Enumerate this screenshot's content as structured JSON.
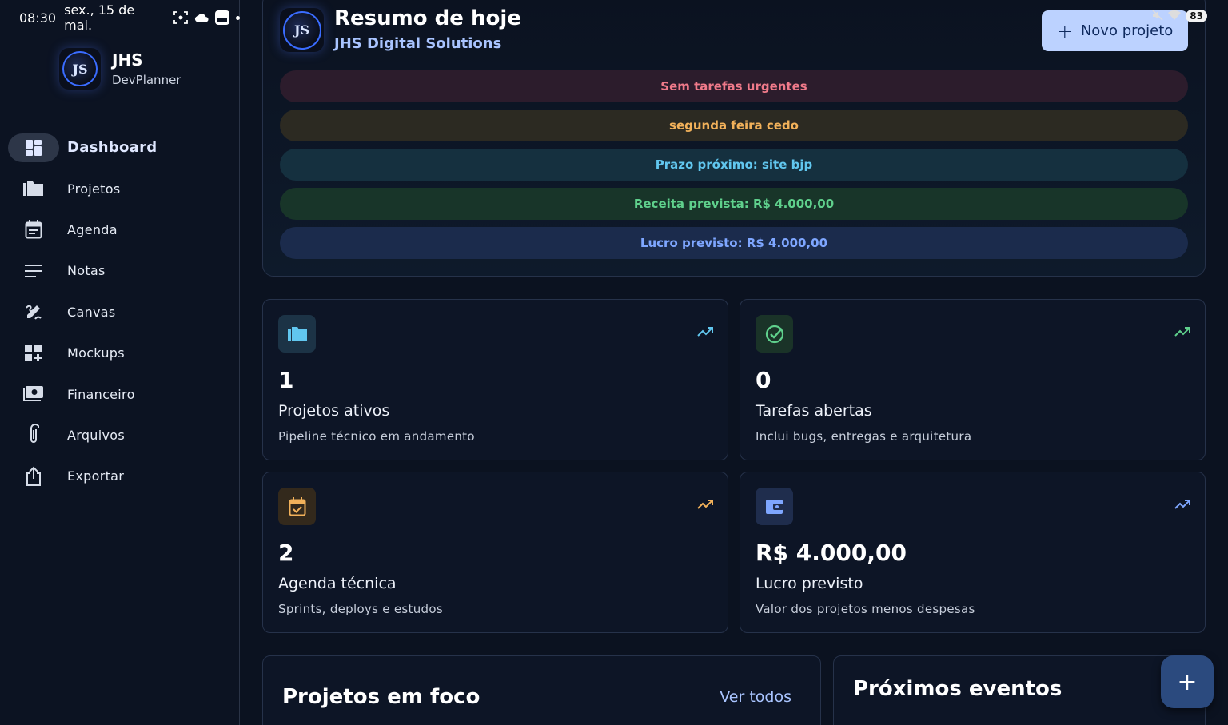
{
  "status_bar": {
    "time": "08:30",
    "date": "sex., 15 de mai.",
    "battery": "83"
  },
  "sidebar": {
    "brand_name": "JHS",
    "brand_sub": "DevPlanner",
    "items": [
      {
        "label": "Dashboard",
        "icon": "dashboard-icon",
        "active": true
      },
      {
        "label": "Projetos",
        "icon": "folder-icon"
      },
      {
        "label": "Agenda",
        "icon": "calendar-icon"
      },
      {
        "label": "Notas",
        "icon": "notes-icon"
      },
      {
        "label": "Canvas",
        "icon": "draw-icon"
      },
      {
        "label": "Mockups",
        "icon": "widgets-icon"
      },
      {
        "label": "Financeiro",
        "icon": "money-icon"
      },
      {
        "label": "Arquivos",
        "icon": "paperclip-icon"
      },
      {
        "label": "Exportar",
        "icon": "share-icon"
      }
    ]
  },
  "header": {
    "title": "Resumo de hoje",
    "subtitle": "JHS Digital Solutions",
    "new_project_label": "Novo projeto"
  },
  "alerts": [
    {
      "text": "Sem tarefas urgentes",
      "color": "#f07a8a"
    },
    {
      "text": "segunda feira cedo",
      "color": "#f2b15a"
    },
    {
      "text": "Prazo próximo: site bjp",
      "color": "#61c7ef"
    },
    {
      "text": "Receita prevista: R$ 4.000,00",
      "color": "#5fd08c"
    },
    {
      "text": "Lucro previsto: R$ 4.000,00",
      "color": "#7ea6ff"
    }
  ],
  "stats": [
    {
      "value": "1",
      "title": "Projetos ativos",
      "desc": "Pipeline técnico em andamento",
      "icon": "folder-icon",
      "accent": "#61c7ef"
    },
    {
      "value": "0",
      "title": "Tarefas abertas",
      "desc": "Inclui bugs, entregas e arquitetura",
      "icon": "check-circle-icon",
      "accent": "#5fd08c"
    },
    {
      "value": "2",
      "title": "Agenda técnica",
      "desc": "Sprints, deploys e estudos",
      "icon": "calendar-check-icon",
      "accent": "#f2b15a"
    },
    {
      "value": "R$ 4.000,00",
      "title": "Lucro previsto",
      "desc": "Valor dos projetos menos despesas",
      "icon": "wallet-icon",
      "accent": "#7ea6ff"
    }
  ],
  "panels": {
    "focus_title": "Projetos em foco",
    "focus_link": "Ver todos",
    "events_title": "Próximos eventos"
  },
  "fab_label": "+"
}
